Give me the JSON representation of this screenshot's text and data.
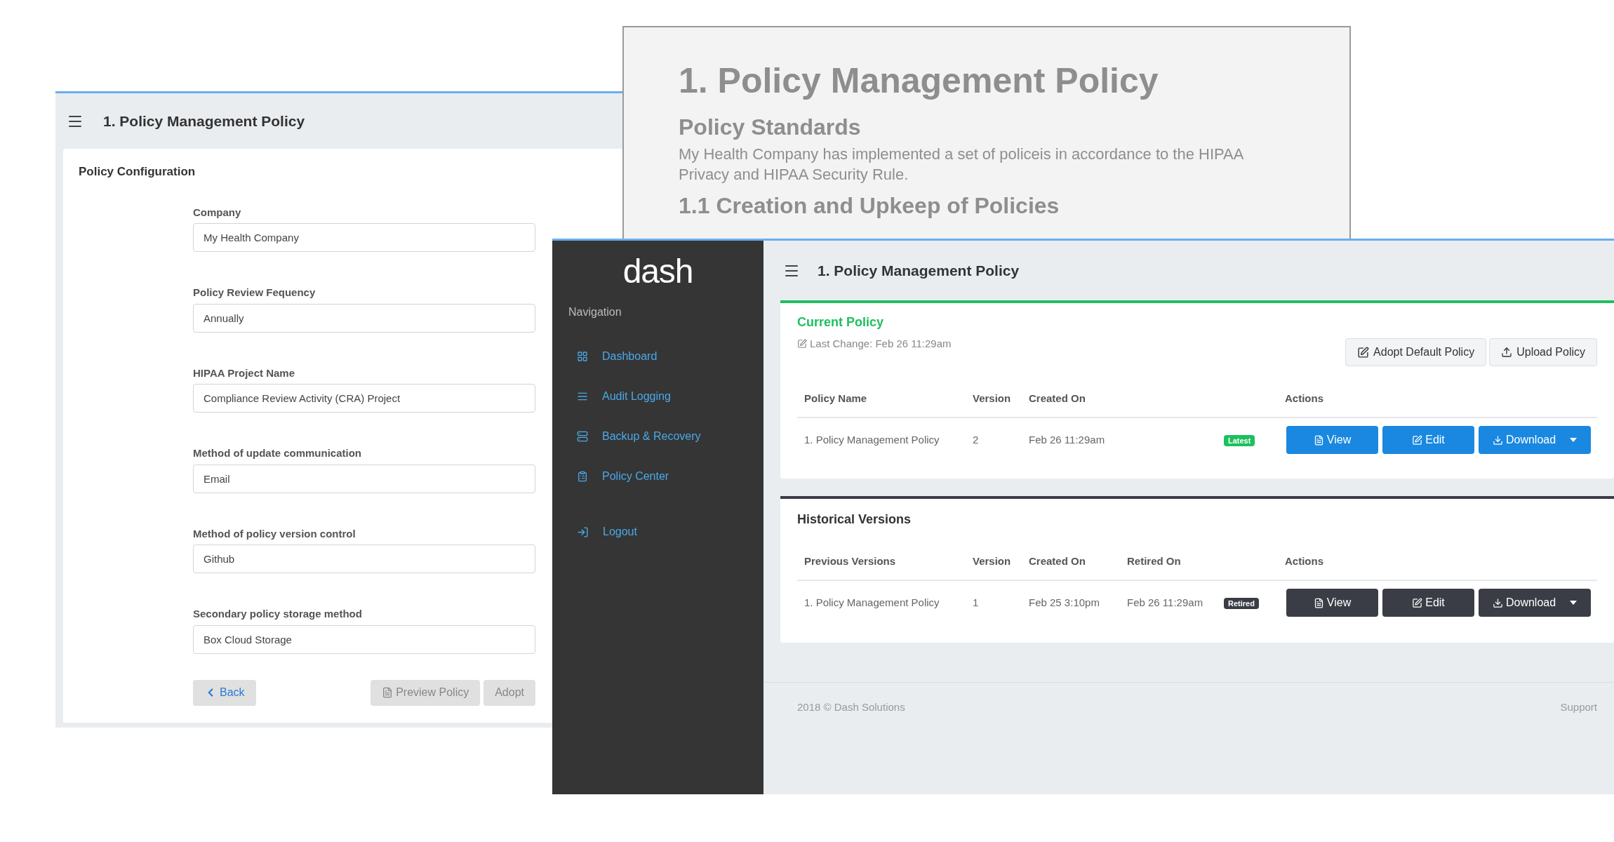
{
  "left_window": {
    "title": "1. Policy Management Policy",
    "section_title": "Policy Configuration",
    "fields": [
      {
        "label": "Company",
        "value": "My Health Company"
      },
      {
        "label": "Policy Review Fequency",
        "value": "Annually"
      },
      {
        "label": "HIPAA Project Name",
        "value": "Compliance Review Activity (CRA) Project"
      },
      {
        "label": "Method of update communication",
        "value": "Email"
      },
      {
        "label": "Method of policy version control",
        "value": "Github"
      },
      {
        "label": "Secondary policy storage method",
        "value": "Box Cloud Storage"
      }
    ],
    "back_button": {
      "label": "Back",
      "disabled": false
    },
    "buttons": [
      {
        "label": "Preview Policy",
        "disabled": true
      },
      {
        "label": "Adopt",
        "disabled": true
      }
    ]
  },
  "document_window": {
    "title": "1. Policy Management Policy",
    "heading": "Policy Standards",
    "paragraph": "My Health Company has implemented a set of policeis in accordance to the HIPAA Privacy and HIPAA Security Rule.",
    "subheading": "1.1 Creation and Upkeep of Policies"
  },
  "dash_window": {
    "logo": "dash",
    "nav_heading": "Navigation",
    "nav_items": [
      {
        "label": "Dashboard"
      },
      {
        "label": "Audit Logging"
      },
      {
        "label": "Backup & Recovery"
      },
      {
        "label": "Policy Center"
      }
    ],
    "logout": "Logout",
    "header_title": "1. Policy Management Policy",
    "current_policy": {
      "title": "Current Policy",
      "last_change": "Last Change: Feb 26 11:29am",
      "buttons": [
        "Adopt Default Policy",
        "Upload Policy"
      ],
      "columns": [
        "Policy Name",
        "Version",
        "Created On"
      ],
      "actions_heading": "Actions",
      "rows": [
        {
          "cells": [
            "1. Policy Management Policy",
            "2",
            "Feb 26 11:29am"
          ],
          "badge": {
            "label": "Latest",
            "kind": "latest"
          },
          "actions": [
            "View",
            "Edit",
            "Download"
          ],
          "kind": "primary"
        }
      ]
    },
    "historical": {
      "title": "Historical Versions",
      "columns": [
        "Previous Versions",
        "Version",
        "Created On",
        "Retired On"
      ],
      "actions_heading": "Actions",
      "rows": [
        {
          "cells": [
            "1. Policy Management Policy",
            "1",
            "Feb 25 3:10pm",
            "Feb 26 11:29am"
          ],
          "badge": {
            "label": "Retired",
            "kind": "retired"
          },
          "actions": [
            "View",
            "Edit",
            "Download"
          ],
          "kind": "dark"
        }
      ]
    },
    "footer": {
      "copyright": "2018 © Dash Solutions",
      "support": "Support"
    }
  }
}
